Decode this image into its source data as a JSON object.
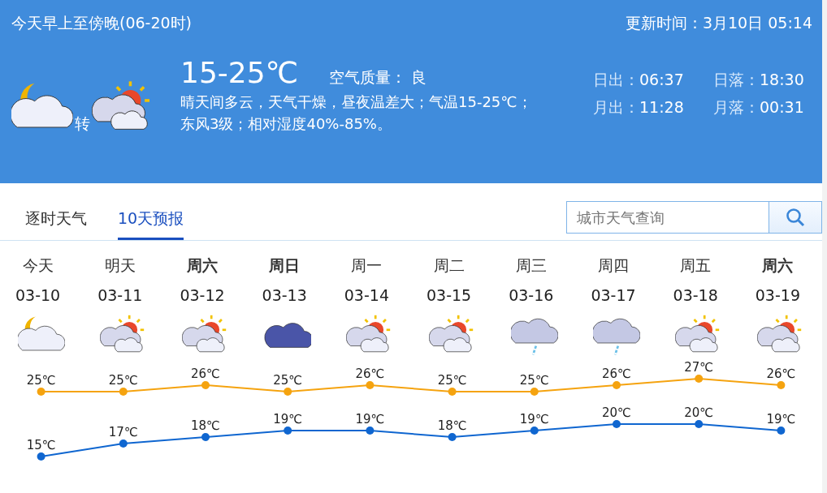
{
  "header": {
    "title": "今天早上至傍晚(06-20时)",
    "updated": "更新时间：3月10日 05:14",
    "icons": [
      {
        "kind": "moon-cloud"
      },
      {
        "kind": "sun-cloud"
      }
    ],
    "connector": "转",
    "temperature": "15-25℃",
    "air_quality_label": "空气质量：",
    "air_quality": "良",
    "description_lines": [
      "晴天间多云，天气干燥，昼夜温差大；气温15-25℃；",
      "东风3级；相对湿度40%-85%。"
    ],
    "astro": [
      {
        "label": "日出：",
        "time": "06:37"
      },
      {
        "label": "日落：",
        "time": "18:30"
      },
      {
        "label": "月出：",
        "time": "11:28"
      },
      {
        "label": "月落：",
        "time": "00:31"
      }
    ]
  },
  "tabs": [
    {
      "label": "逐时天气",
      "selected": false
    },
    {
      "label": "10天预报",
      "selected": true
    }
  ],
  "search": {
    "placeholder": "城市天气查询"
  },
  "days": [
    {
      "day": "今天",
      "date": "03-10",
      "weekend": false,
      "kind": "moon-cloud"
    },
    {
      "day": "明天",
      "date": "03-11",
      "weekend": false,
      "kind": "sun-cloud"
    },
    {
      "day": "周六",
      "date": "03-12",
      "weekend": true,
      "kind": "sun-cloud"
    },
    {
      "day": "周日",
      "date": "03-13",
      "weekend": true,
      "kind": "overcast"
    },
    {
      "day": "周一",
      "date": "03-14",
      "weekend": false,
      "kind": "sun-cloud"
    },
    {
      "day": "周二",
      "date": "03-15",
      "weekend": false,
      "kind": "sun-cloud"
    },
    {
      "day": "周三",
      "date": "03-16",
      "weekend": false,
      "kind": "rain"
    },
    {
      "day": "周四",
      "date": "03-17",
      "weekend": false,
      "kind": "rain"
    },
    {
      "day": "周五",
      "date": "03-18",
      "weekend": false,
      "kind": "sun-cloud"
    },
    {
      "day": "周六",
      "date": "03-19",
      "weekend": true,
      "kind": "sun-cloud"
    }
  ],
  "chart_data": {
    "type": "line",
    "series": [
      {
        "color": "#f5a30f",
        "marker": "circle",
        "values": [
          25,
          25,
          26,
          25,
          26,
          25,
          25,
          26,
          27,
          26
        ],
        "value_labels": [
          "25℃",
          "25℃",
          "26℃",
          "25℃",
          "26℃",
          "25℃",
          "25℃",
          "26℃",
          "27℃",
          "26℃"
        ]
      },
      {
        "color": "#0f66d0",
        "marker": "circle",
        "values": [
          15,
          17,
          18,
          19,
          19,
          18,
          19,
          20,
          20,
          19
        ],
        "value_labels": [
          "15℃",
          "17℃",
          "18℃",
          "19℃",
          "19℃",
          "18℃",
          "19℃",
          "20℃",
          "20℃",
          "19℃"
        ]
      }
    ]
  }
}
